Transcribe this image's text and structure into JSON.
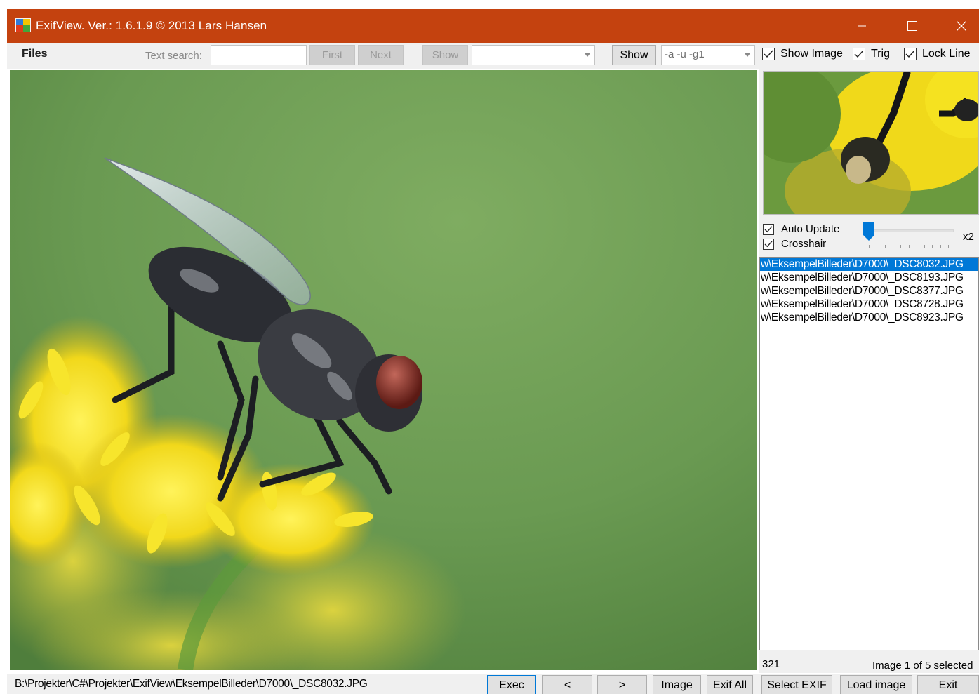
{
  "window": {
    "title": "ExifView. Ver.: 1.6.1.9 © 2013 Lars Hansen"
  },
  "toolbar": {
    "files_menu": "Files",
    "text_search_label": "Text search:",
    "text_search_value": "",
    "first_label": "First",
    "next_label": "Next",
    "show_disabled_label": "Show",
    "combo_value": "",
    "show_label": "Show",
    "args_value": "-a -u -g1",
    "show_image_label": "Show Image",
    "trig_label": "Trig",
    "lock_line_label": "Lock Line",
    "show_image_checked": true,
    "trig_checked": true,
    "lock_line_checked": true
  },
  "preview": {
    "auto_update_label": "Auto Update",
    "crosshair_label": "Crosshair",
    "auto_update_checked": true,
    "crosshair_checked": true,
    "zoom_label": "x2",
    "slider_level": 0
  },
  "files": [
    "w\\EksempelBilleder\\D7000\\_DSC8032.JPG",
    "w\\EksempelBilleder\\D7000\\_DSC8193.JPG",
    "w\\EksempelBilleder\\D7000\\_DSC8377.JPG",
    "w\\EksempelBilleder\\D7000\\_DSC8728.JPG",
    "w\\EksempelBilleder\\D7000\\_DSC8923.JPG"
  ],
  "selected_index": 0,
  "status": {
    "count": "321",
    "selection": "Image 1 of 5 selected",
    "path": "B:\\Projekter\\C#\\Projekter\\ExifView\\EksempelBilleder\\D7000\\_DSC8032.JPG"
  },
  "buttons": {
    "exec": "Exec",
    "prev": "<",
    "next": ">",
    "image": "Image",
    "exif_all": "Exif All",
    "select_exif": "Select EXIF",
    "load_image": "Load image",
    "exit": "Exit"
  },
  "icons": {
    "app": "app-icon",
    "minimize": "minimize-icon",
    "maximize": "maximize-icon",
    "close": "close-icon",
    "checkmark": "checkmark-icon",
    "dropdown": "chevron-down-icon"
  },
  "colors": {
    "titlebar": "#c4420f",
    "selection": "#0078d7"
  }
}
